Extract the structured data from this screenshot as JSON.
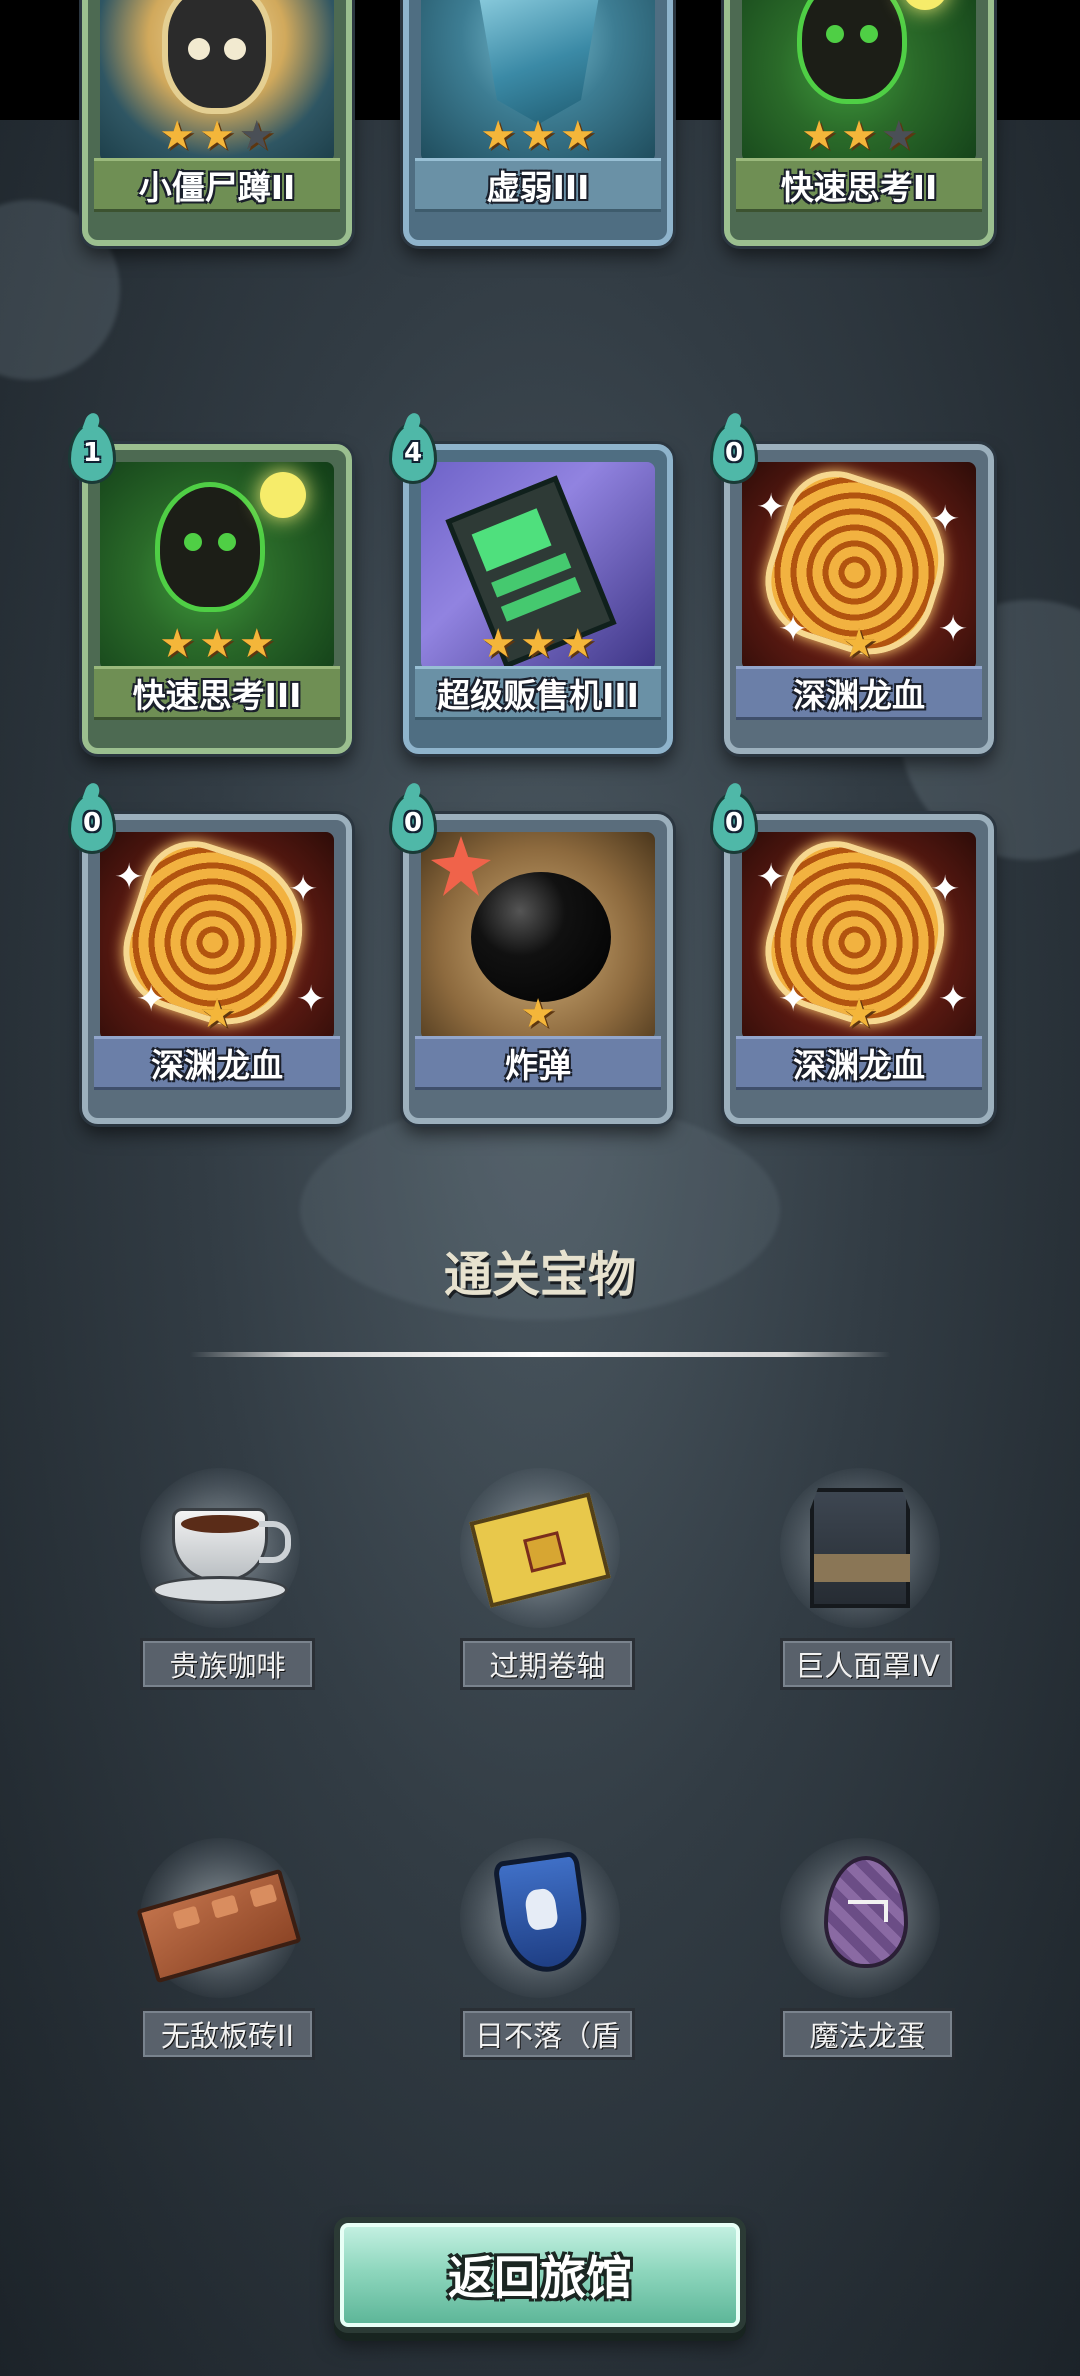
{
  "cards": [
    {
      "name": "小僵尸蹲II",
      "stars": 2,
      "cost": null,
      "theme": "green",
      "art": "zombie"
    },
    {
      "name": "虚弱III",
      "stars": 3,
      "cost": null,
      "theme": "blue",
      "art": "shield"
    },
    {
      "name": "快速思考II",
      "stars": 2,
      "cost": null,
      "theme": "green",
      "art": "think"
    },
    {
      "name": "快速思考III",
      "stars": 3,
      "cost": "1",
      "theme": "green",
      "art": "think"
    },
    {
      "name": "超级贩售机III",
      "stars": 3,
      "cost": "4",
      "theme": "blue",
      "art": "vend"
    },
    {
      "name": "深渊龙血",
      "stars": 1,
      "cost": "0",
      "theme": "gray",
      "art": "blood"
    },
    {
      "name": "深渊龙血",
      "stars": 1,
      "cost": "0",
      "theme": "gray",
      "art": "blood"
    },
    {
      "name": "炸弹",
      "stars": 1,
      "cost": "0",
      "theme": "gray",
      "art": "bomb"
    },
    {
      "name": "深渊龙血",
      "stars": 1,
      "cost": "0",
      "theme": "gray",
      "art": "blood"
    }
  ],
  "treasure_section": {
    "title": "通关宝物",
    "items": [
      {
        "name": "贵族咖啡",
        "icon": "coffee-cup-icon"
      },
      {
        "name": "过期卷轴",
        "icon": "scroll-icon"
      },
      {
        "name": "巨人面罩IV",
        "icon": "giant-mask-icon"
      },
      {
        "name": "无敌板砖II",
        "icon": "brick-icon"
      },
      {
        "name": "日不落（盾",
        "icon": "shield-icon"
      },
      {
        "name": "魔法龙蛋",
        "icon": "dragon-egg-icon"
      }
    ]
  },
  "return_button": {
    "label": "返回旅馆"
  }
}
